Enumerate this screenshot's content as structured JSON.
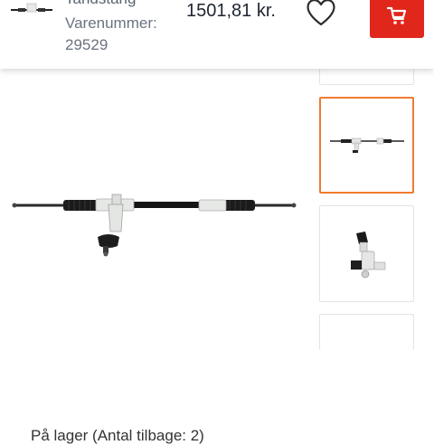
{
  "header": {
    "title": "Tandstang",
    "item_number_label": "Varenummer:",
    "item_number_value": "29529",
    "price": "1501,81 kr.",
    "wishlist_icon": "heart-icon",
    "cart_icon": "shopping-cart-icon",
    "cart_button_color": "#e1261c"
  },
  "gallery": {
    "selected_thumbnail": 1,
    "thumbnails": [
      "steering-rack-front-view",
      "steering-rack-pinion-view"
    ],
    "selected_border_color": "#f07a30"
  },
  "section": {
    "heading": "På lager (Antal tilbage: 2)"
  }
}
